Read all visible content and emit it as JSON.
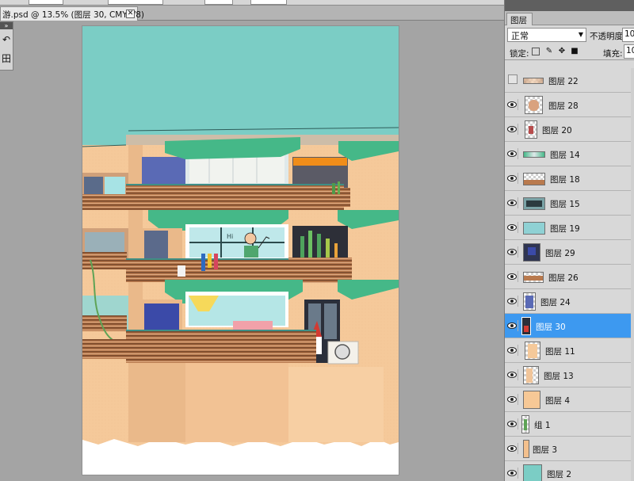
{
  "document_tab": {
    "title": "游.psd @ 13.5% (图层 30, CMYK/8)",
    "close_glyph": "✕"
  },
  "tools_panel": {
    "close_glyph": "»",
    "icons": [
      "history-brush-icon",
      "grid-icon"
    ],
    "icon_glyphs": [
      "↶",
      "田"
    ]
  },
  "layers_panel": {
    "tab_label": "图层",
    "blend_mode": "正常",
    "opacity_label": "不透明度:",
    "opacity_value": "100",
    "lock_label": "锁定:",
    "fill_label": "填充:",
    "fill_value": "100",
    "colors": {
      "selected": "#3d99f0",
      "panel": "#d8d8d8"
    },
    "layers": [
      {
        "name": "图层 22",
        "visible": false,
        "thumb": "strip"
      },
      {
        "name": "图层 28",
        "visible": true,
        "thumb": "blob"
      },
      {
        "name": "图层 20",
        "visible": true,
        "thumb": "figure"
      },
      {
        "name": "图层 14",
        "visible": true,
        "thumb": "rail"
      },
      {
        "name": "图层 18",
        "visible": true,
        "thumb": "balcony"
      },
      {
        "name": "图层 15",
        "visible": true,
        "thumb": "window"
      },
      {
        "name": "图层 19",
        "visible": true,
        "thumb": "teal"
      },
      {
        "name": "图层 29",
        "visible": true,
        "thumb": "dark"
      },
      {
        "name": "图层 26",
        "visible": true,
        "thumb": "railwide"
      },
      {
        "name": "图层 24",
        "visible": true,
        "thumb": "blue"
      },
      {
        "name": "图层 30",
        "visible": true,
        "thumb": "door",
        "selected": true
      },
      {
        "name": "图层 11",
        "visible": true,
        "thumb": "wall"
      },
      {
        "name": "图层 13",
        "visible": true,
        "thumb": "wallsm"
      },
      {
        "name": "图层 4",
        "visible": true,
        "thumb": "peach"
      },
      {
        "name": "组 1",
        "visible": true,
        "thumb": "group"
      },
      {
        "name": "图层 3",
        "visible": true,
        "thumb": "peachnarrow"
      },
      {
        "name": "图层 2",
        "visible": true,
        "thumb": "sky"
      }
    ]
  },
  "artwork": {
    "sky_color": "#7bcdc5",
    "wall_color": "#f5c99a",
    "awning_color": "#45b888",
    "sign_text": "Hi"
  }
}
